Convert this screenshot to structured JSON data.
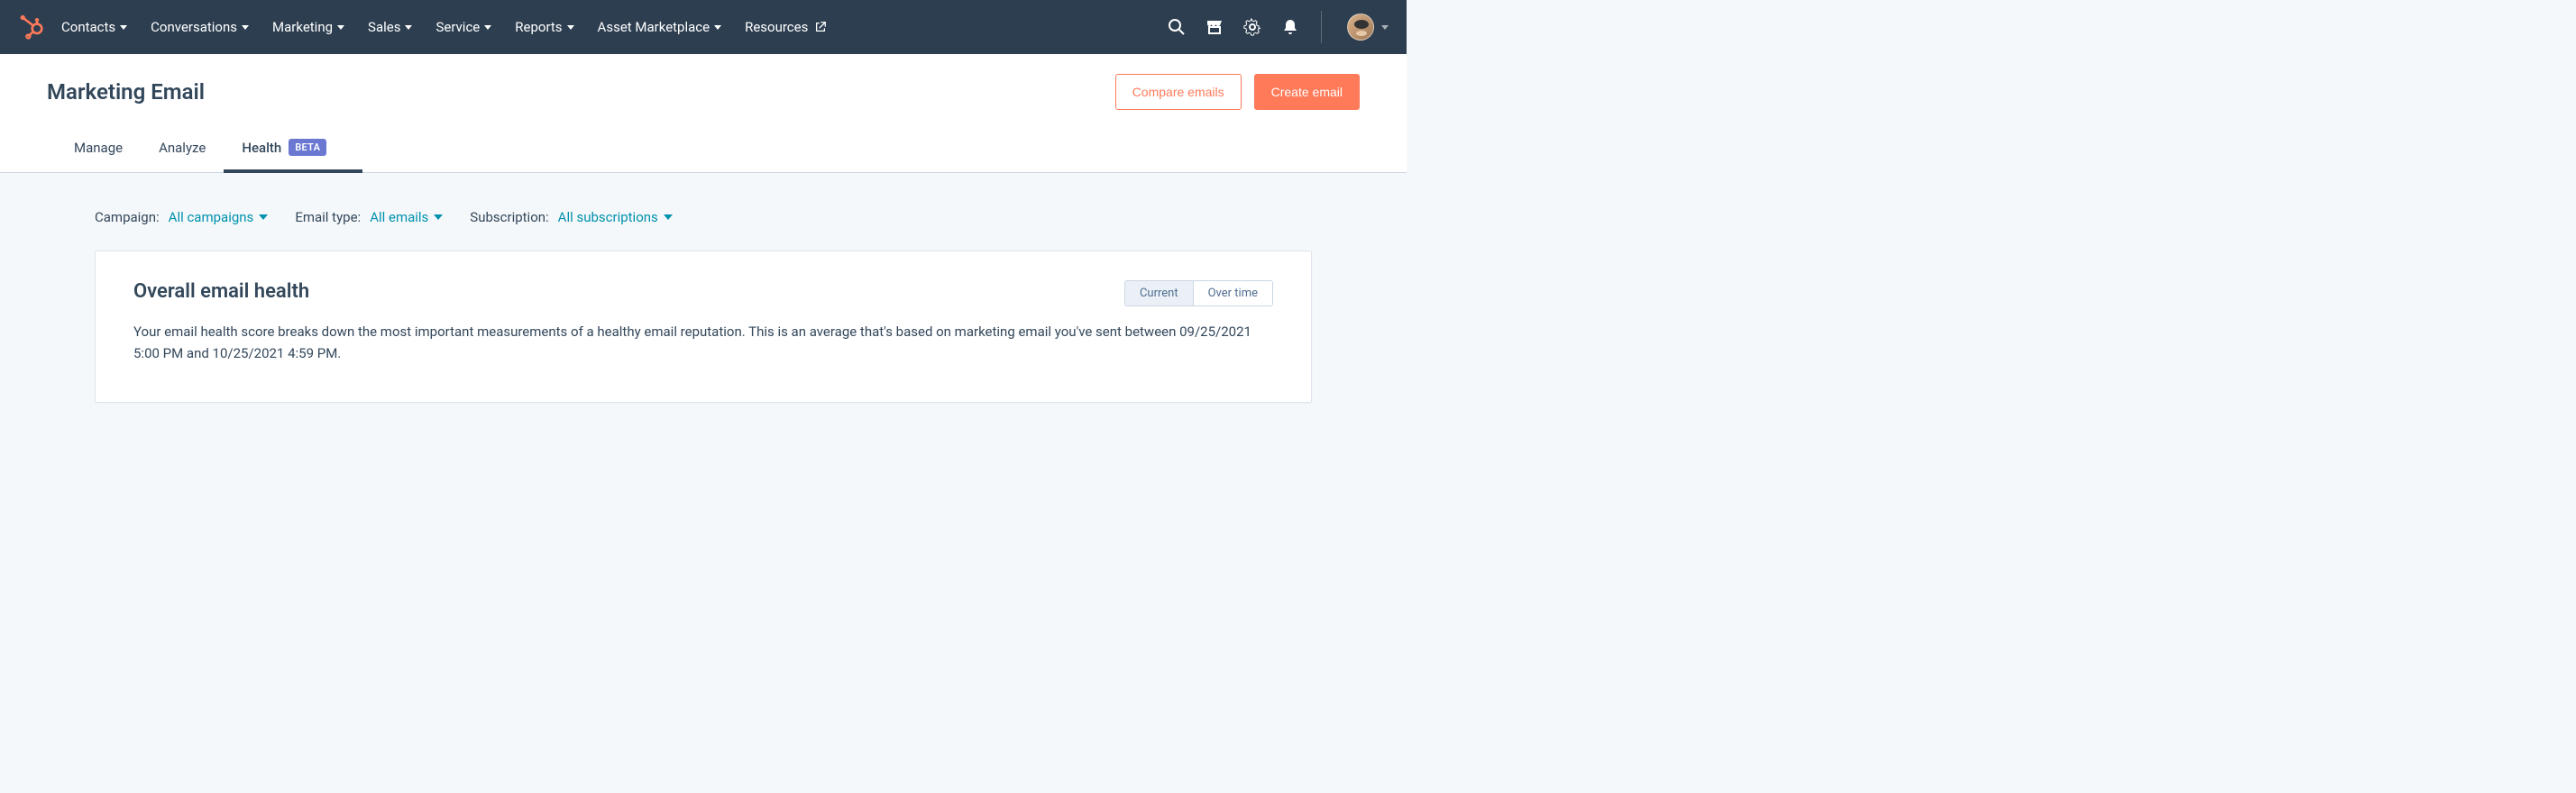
{
  "nav": {
    "items": [
      {
        "label": "Contacts"
      },
      {
        "label": "Conversations"
      },
      {
        "label": "Marketing"
      },
      {
        "label": "Sales"
      },
      {
        "label": "Service"
      },
      {
        "label": "Reports"
      },
      {
        "label": "Asset Marketplace"
      }
    ],
    "resources_label": "Resources"
  },
  "header": {
    "title": "Marketing Email",
    "compare_label": "Compare emails",
    "create_label": "Create email"
  },
  "tabs": {
    "manage": "Manage",
    "analyze": "Analyze",
    "health": "Health",
    "health_badge": "BETA"
  },
  "filters": {
    "campaign_label": "Campaign:",
    "campaign_value": "All campaigns",
    "email_type_label": "Email type:",
    "email_type_value": "All emails",
    "subscription_label": "Subscription:",
    "subscription_value": "All subscriptions"
  },
  "panel": {
    "title": "Overall email health",
    "description": "Your email health score breaks down the most important measurements of a healthy email reputation. This is an average that's based on marketing email you've sent between 09/25/2021 5:00 PM and 10/25/2021 4:59 PM.",
    "segmented_current": "Current",
    "segmented_over_time": "Over time"
  }
}
